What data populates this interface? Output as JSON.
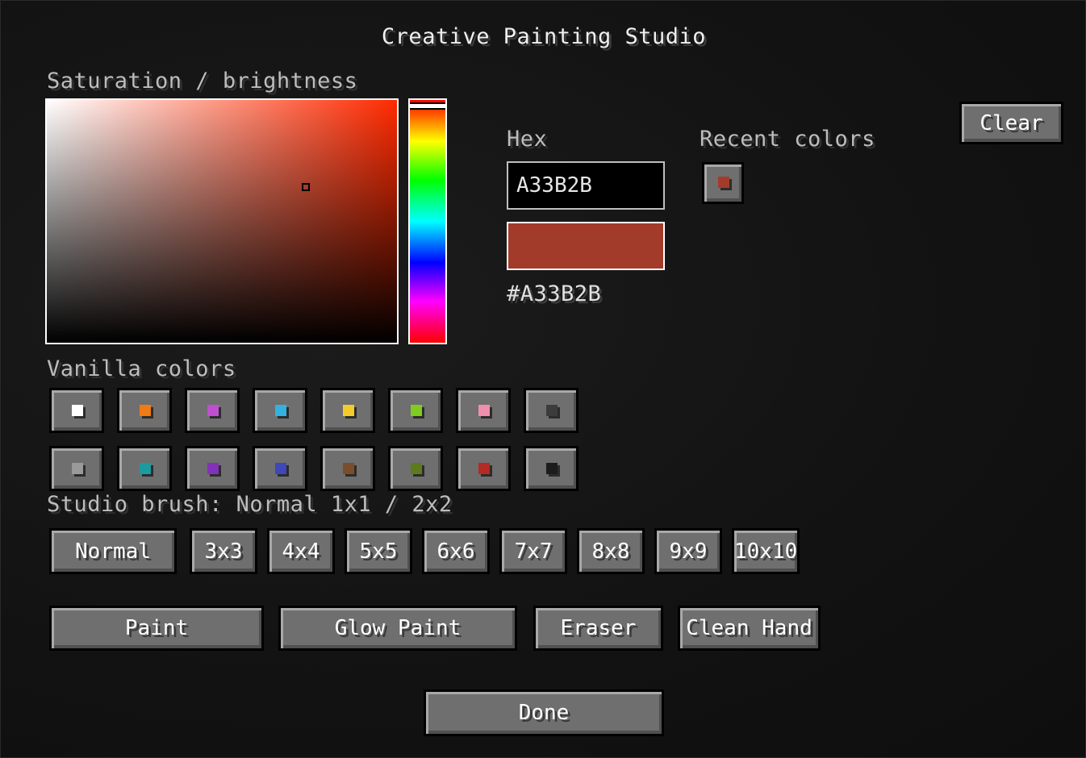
{
  "window": {
    "title": "Creative Painting Studio"
  },
  "picker": {
    "sb_label": "Saturation / brightness",
    "hex_label": "Hex",
    "hex_value": "A33B2B",
    "hex_display": "#A33B2B",
    "current_color": "#A33B2B",
    "hue_color": "#ff2a00",
    "saturation": 0.74,
    "brightness": 0.64,
    "hue": 0.02
  },
  "recent": {
    "label": "Recent colors",
    "colors": [
      "#A33B2B"
    ]
  },
  "clear_label": "Clear",
  "vanilla": {
    "label": "Vanilla colors",
    "row1": [
      "#ffffff",
      "#f07a13",
      "#c04fd0",
      "#33b2e0",
      "#f3cc2b",
      "#7fcc20",
      "#f08eae",
      "#3c3c3c"
    ],
    "row2": [
      "#9a9a9a",
      "#1b9a9f",
      "#8332b8",
      "#3e48b8",
      "#7a4e2c",
      "#5e7a1e",
      "#b42a24",
      "#1c1c1c"
    ]
  },
  "brush": {
    "label": "Studio brush: Normal 1x1 / 2x2",
    "sizes": [
      "Normal",
      "3x3",
      "4x4",
      "5x5",
      "6x6",
      "7x7",
      "8x8",
      "9x9",
      "10x10"
    ]
  },
  "tools": [
    "Paint",
    "Glow Paint",
    "Eraser",
    "Clean Hand"
  ],
  "done_label": "Done"
}
